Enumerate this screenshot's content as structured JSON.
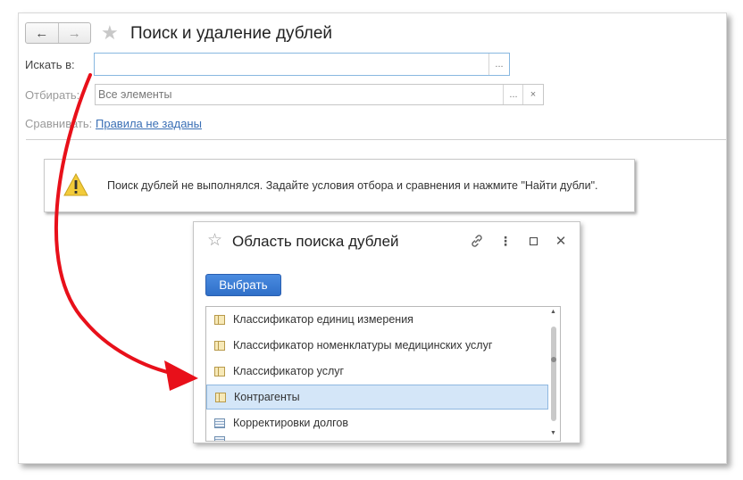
{
  "window": {
    "title": "Поиск и удаление дублей",
    "nav": {
      "back_icon": "←",
      "forward_icon": "→"
    },
    "star_icon": "★"
  },
  "form": {
    "search_in": {
      "label": "Искать в:",
      "value": "",
      "button": "..."
    },
    "filter": {
      "label": "Отбирать:",
      "placeholder": "Все элементы",
      "button": "...",
      "clear": "×"
    },
    "compare": {
      "label": "Сравнивать:",
      "link": "Правила не заданы"
    }
  },
  "warning": {
    "icon": "!",
    "text": "Поиск дублей не выполнялся.  Задайте условия отбора и сравнения и нажмите \"Найти дубли\"."
  },
  "dialog": {
    "title": "Область поиска дублей",
    "star_icon": "☆",
    "link_icon": "🔗",
    "menu_icon": "⋮",
    "maximize_icon": "☐",
    "close_icon": "✕",
    "select_button": "Выбрать",
    "items": [
      {
        "label": "Классификатор единиц измерения",
        "icon": "table-icon"
      },
      {
        "label": "Классификатор номенклатуры медицинских услуг",
        "icon": "table-icon"
      },
      {
        "label": "Классификатор услуг",
        "icon": "table-icon"
      },
      {
        "label": "Контрагенты",
        "icon": "table-icon",
        "selected": true
      },
      {
        "label": "Корректировки долгов",
        "icon": "document-icon"
      }
    ],
    "scroll_up": "▲",
    "scroll_down": "▼"
  }
}
